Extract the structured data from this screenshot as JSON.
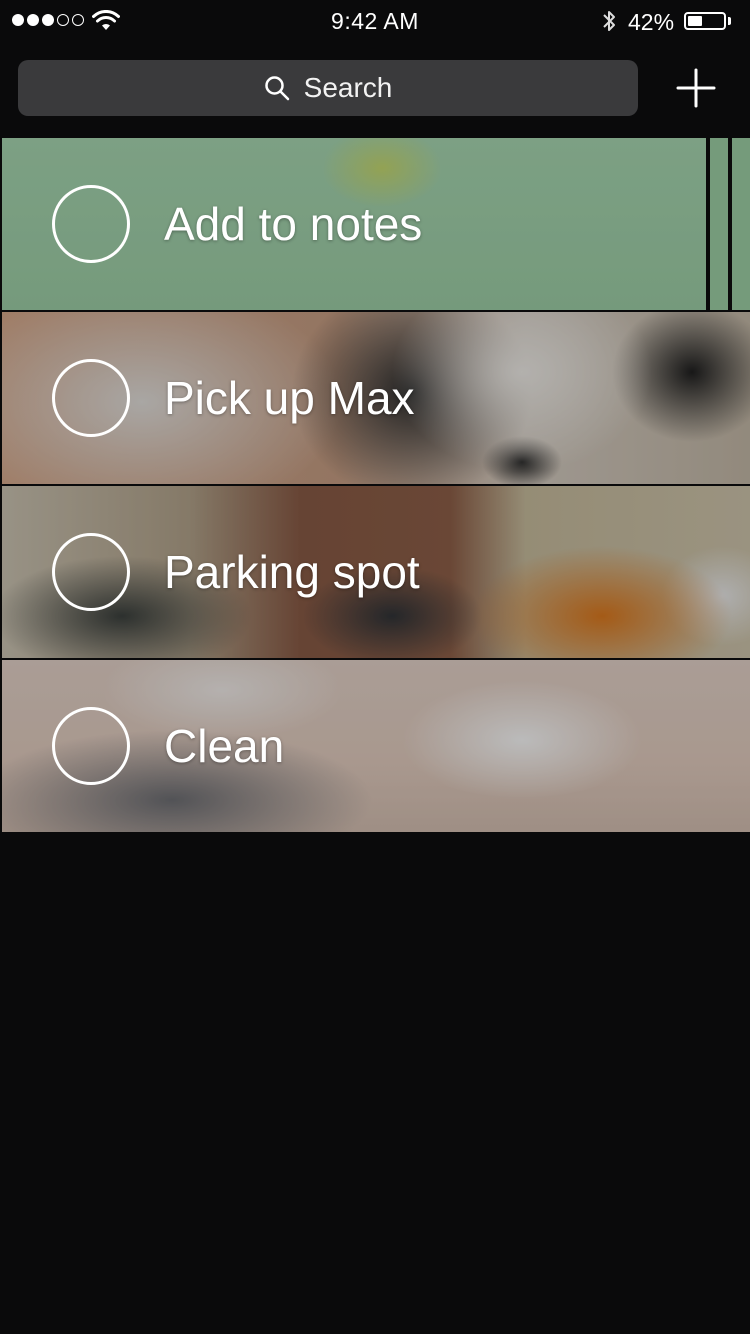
{
  "status_bar": {
    "time": "9:42 AM",
    "battery_percent": "42%",
    "battery_level": 0.42,
    "signal_bars_filled": 3,
    "signal_bars_total": 5,
    "signal_icon": "cellular-dots-icon",
    "wifi_icon": "wifi-icon",
    "bluetooth_icon": "bluetooth-icon",
    "battery_icon": "battery-icon"
  },
  "header": {
    "search": {
      "label": "Search",
      "icon": "search-icon"
    },
    "add_icon": "plus-icon"
  },
  "tasks": [
    {
      "label": "Add to notes",
      "completed": false,
      "background": "whiteboard-diagram-photo"
    },
    {
      "label": "Pick up Max",
      "completed": false,
      "background": "dog-photo"
    },
    {
      "label": "Parking spot",
      "completed": false,
      "background": "street-cars-photo"
    },
    {
      "label": "Clean",
      "completed": false,
      "background": "unmade-bed-photo"
    }
  ],
  "colors": {
    "background": "#0a0a0b",
    "search_field": "#3a3a3c",
    "foreground": "#ffffff"
  }
}
